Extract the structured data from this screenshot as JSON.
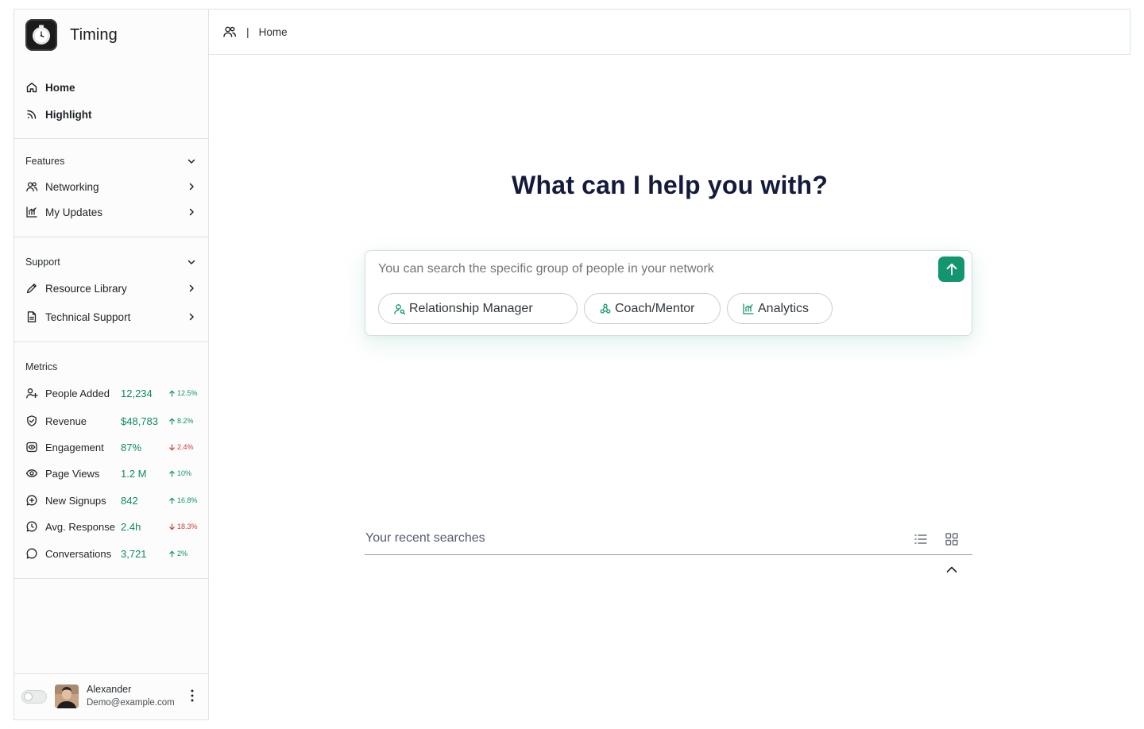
{
  "brand": {
    "name": "Timing"
  },
  "nav": {
    "home": "Home",
    "highlight": "Highlight"
  },
  "features": {
    "title": "Features",
    "items": [
      {
        "label": "Networking",
        "icon": "users-icon"
      },
      {
        "label": "My Updates",
        "icon": "bar-chart-icon"
      }
    ]
  },
  "support": {
    "title": "Support",
    "items": [
      {
        "label": "Resource Library",
        "icon": "pencil-icon"
      },
      {
        "label": "Technical Support",
        "icon": "document-icon"
      }
    ]
  },
  "metrics": {
    "title": "Metrics",
    "items": [
      {
        "label": "People Added",
        "value": "12,234",
        "delta": "12.5%",
        "direction": "up",
        "icon": "user-plus-icon"
      },
      {
        "label": "Revenue",
        "value": "$48,783",
        "delta": "8.2%",
        "direction": "up",
        "icon": "shield-check-icon"
      },
      {
        "label": "Engagement",
        "value": "87%",
        "delta": "2.4%",
        "direction": "down",
        "icon": "engagement-icon"
      },
      {
        "label": "Page Views",
        "value": "1.2 M",
        "delta": "10%",
        "direction": "up",
        "icon": "eye-icon"
      },
      {
        "label": "New Signups",
        "value": "842",
        "delta": "16.8%",
        "direction": "up",
        "icon": "chat-plus-icon"
      },
      {
        "label": "Avg. Response",
        "value": "2.4h",
        "delta": "18.3%",
        "direction": "down",
        "icon": "chat-clock-icon"
      },
      {
        "label": "Conversations",
        "value": "3,721",
        "delta": "2%",
        "direction": "up",
        "icon": "chat-icon"
      }
    ]
  },
  "user": {
    "name": "Alexander",
    "email": "Demo@example.com"
  },
  "header": {
    "breadcrumb_sep": "|",
    "breadcrumb_home": "Home"
  },
  "main": {
    "title": "What can I help you with?",
    "search_placeholder": "You can search the specific group of people in your network",
    "chips": [
      {
        "label": "Relationship Manager",
        "icon": "user-search-icon"
      },
      {
        "label": "Coach/Mentor",
        "icon": "group-icon"
      },
      {
        "label": "Analytics",
        "icon": "analytics-icon"
      }
    ],
    "recent_title": "Your recent searches"
  },
  "colors": {
    "accent": "#139670",
    "metric_value": "#0f8a66",
    "delta_up": "#12936c",
    "delta_down": "#d23b3b",
    "title": "#141a3c"
  }
}
